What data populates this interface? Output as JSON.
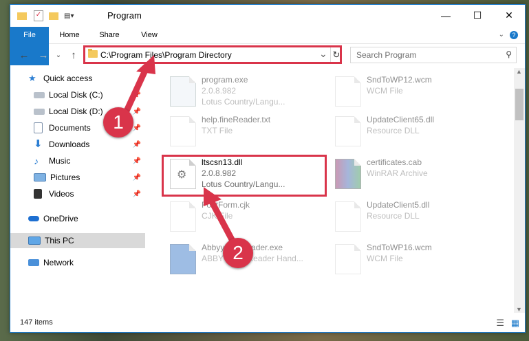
{
  "window": {
    "title": "Program"
  },
  "ribbon": {
    "tabs": [
      "File",
      "Home",
      "Share",
      "View"
    ],
    "help": "?"
  },
  "address": {
    "path": "C:\\Program Files\\Program Directory",
    "dropdown": "⌄",
    "refresh": "↻"
  },
  "search": {
    "placeholder": "Search Program",
    "icon": "search-icon"
  },
  "sidebar": {
    "items": [
      {
        "label": "Quick access"
      },
      {
        "label": "Local Disk (C:)"
      },
      {
        "label": "Local Disk (D:)"
      },
      {
        "label": "Documents"
      },
      {
        "label": "Downloads"
      },
      {
        "label": "Music"
      },
      {
        "label": "Pictures"
      },
      {
        "label": "Videos"
      },
      {
        "label": "OneDrive"
      },
      {
        "label": "This PC"
      },
      {
        "label": "Network"
      }
    ]
  },
  "files": [
    {
      "name": "program.exe",
      "line2": "2.0.8.982",
      "line3": "Lotus Country/Langu..."
    },
    {
      "name": "SndToWP12.wcm",
      "line2": "WCM File"
    },
    {
      "name": "help.fineReader.txt",
      "line2": "TXT File"
    },
    {
      "name": "UpdateClient65.dll",
      "line2": "Resource DLL"
    },
    {
      "name": "ltscsn13.dll",
      "line2": "2.0.8.982",
      "line3": "Lotus Country/Langu..."
    },
    {
      "name": "certificates.cab",
      "line2": "WinRAR Archive"
    },
    {
      "name": "FontForm.cjk",
      "line2": "CJK File"
    },
    {
      "name": "UpdateClient5.dll",
      "line2": "Resource DLL"
    },
    {
      "name": "AbbyyFineReader.exe",
      "line2": "ABBYY FineReader Hand..."
    },
    {
      "name": "SndToWP16.wcm",
      "line2": "WCM File"
    }
  ],
  "status": {
    "count": "147 items"
  },
  "callouts": [
    "1",
    "2"
  ],
  "colors": {
    "accent": "#1979ca",
    "highlight": "#d9344a"
  }
}
